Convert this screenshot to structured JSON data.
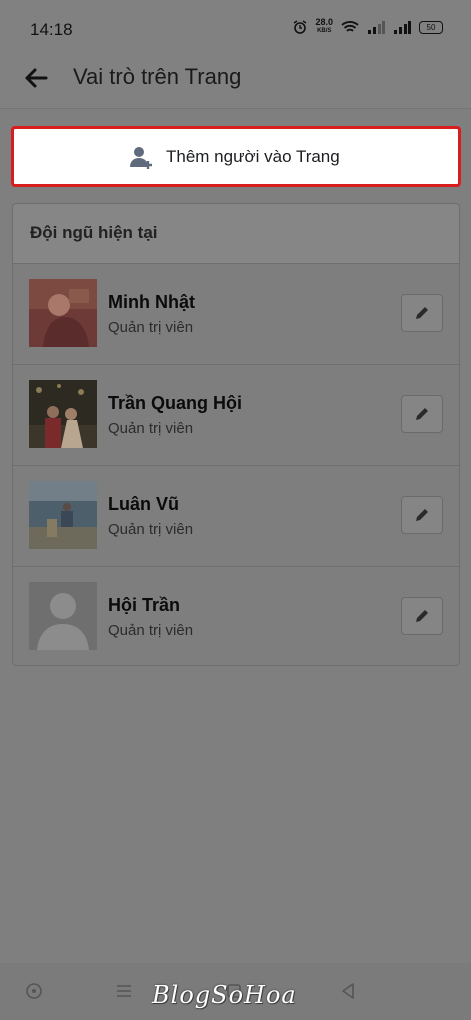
{
  "status_bar": {
    "time": "14:18",
    "speed_value": "28.0",
    "speed_unit": "KB/S",
    "battery": "50"
  },
  "app_bar": {
    "title": "Vai trò trên Trang"
  },
  "add_button": {
    "label": "Thêm người vào Trang"
  },
  "team": {
    "title": "Đội ngũ hiện tại",
    "members": [
      {
        "name": "Minh Nhật",
        "role": "Quản trị viên"
      },
      {
        "name": "Trần Quang Hội",
        "role": "Quản trị viên"
      },
      {
        "name": "Luân Vũ",
        "role": "Quản trị viên"
      },
      {
        "name": "Hội Trần",
        "role": "Quản trị viên"
      }
    ]
  },
  "watermark": "BlogSoHoa",
  "icons": [
    "alarm-icon",
    "wifi-icon",
    "signal-icon",
    "battery-icon",
    "back-arrow-icon",
    "add-person-icon",
    "edit-pencil-icon",
    "nav-home-icon",
    "nav-menu-icon",
    "nav-square-icon",
    "nav-back-icon"
  ]
}
